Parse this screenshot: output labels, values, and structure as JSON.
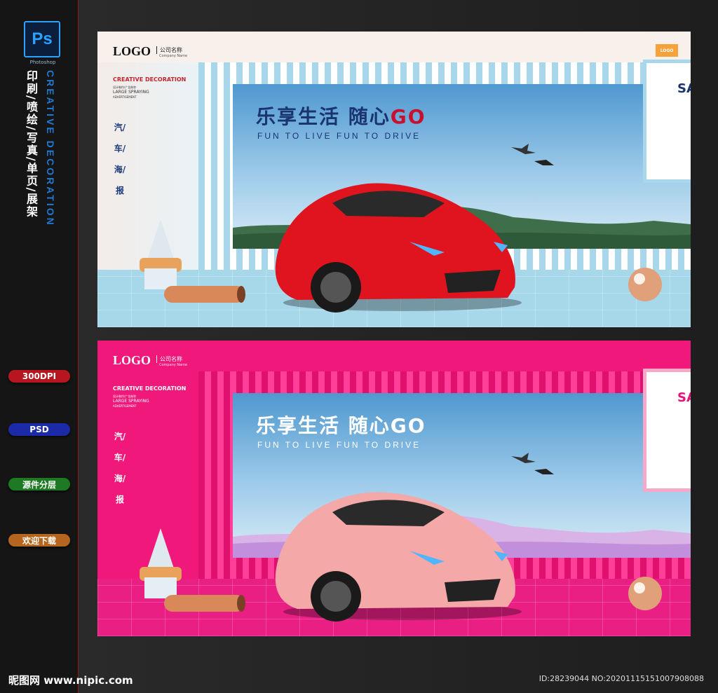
{
  "sidebar": {
    "app_badge": "Ps",
    "app_name": "Photoshop",
    "vertical_cn": "印刷/喷绘/写真/单页/展架",
    "vertical_en": "CREATIVE DECORATION",
    "pills": [
      {
        "label": "300DPI",
        "color": "#b8161e"
      },
      {
        "label": "PSD",
        "color": "#1c2aa8"
      },
      {
        "label": "源件分层",
        "color": "#1d7a22"
      },
      {
        "label": "欢迎下载",
        "color": "#b5651d"
      }
    ]
  },
  "banner": {
    "logo": "LOGO",
    "company": "公司名称",
    "company_en": "Company Name",
    "creative": "CREATIVE DECORATION",
    "small1": "设计制作/广告制作",
    "small2": "LARGE SPRAYING",
    "small3": "ADVERTISEMENT",
    "vertical_tag": "汽/车/海/报",
    "headline_main": "乐享生活  随心",
    "headline_go": "GO",
    "subline": "FUN TO LIVE  FUN TO DRIVE",
    "frame_text": "SA",
    "tag_logo": "LOGO"
  },
  "footer": {
    "watermark": "昵图网 www.nipic.com",
    "id_text": "ID:28239044 NO:20201115151007908088"
  },
  "colors": {
    "top_car": "#e0141e",
    "bottom_car": "#f4a8a8",
    "accent_red": "#c8102e",
    "pink_bg": "#f0187a"
  }
}
